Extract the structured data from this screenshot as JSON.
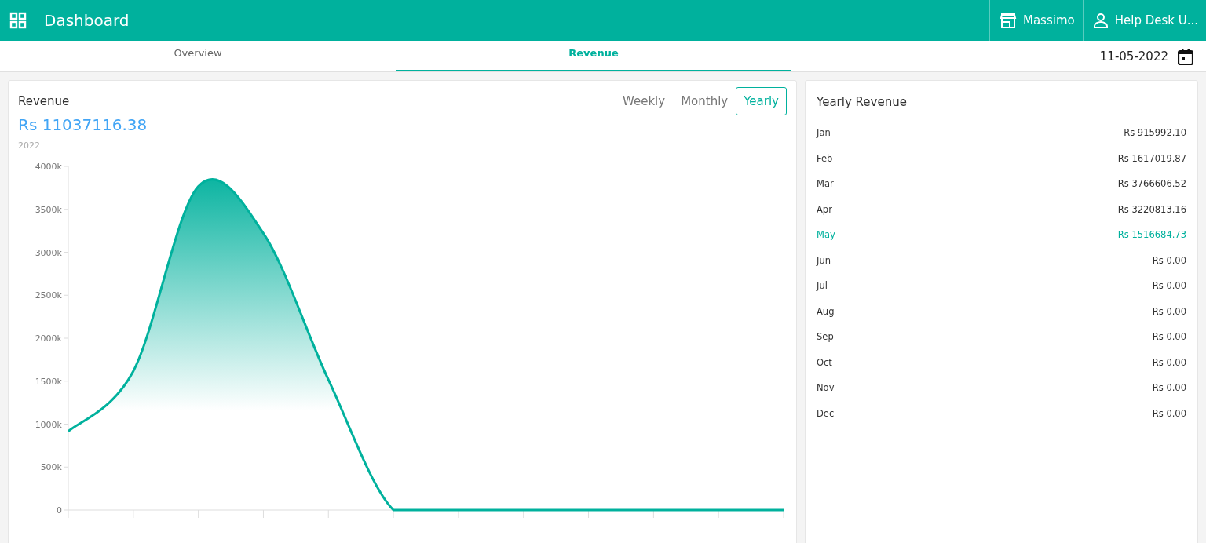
{
  "app_bar": {
    "title": "Dashboard",
    "store": "Massimo",
    "user": "Help Desk U..."
  },
  "tabs": [
    {
      "label": "Overview",
      "selected": false
    },
    {
      "label": "Revenue",
      "selected": true
    }
  ],
  "date": "11-05-2022",
  "revenue_card": {
    "title": "Revenue",
    "total": "Rs 11037116.38",
    "year": "2022",
    "periods": [
      {
        "label": "Weekly",
        "selected": false
      },
      {
        "label": "Monthly",
        "selected": false
      },
      {
        "label": "Yearly",
        "selected": true
      }
    ],
    "chart_data": {
      "type": "area",
      "ylim": [
        0,
        4000000
      ],
      "yticks": [
        {
          "value": 0,
          "label": "0"
        },
        {
          "value": 500000,
          "label": "500k"
        },
        {
          "value": 1000000,
          "label": "1000k"
        },
        {
          "value": 1500000,
          "label": "1500k"
        },
        {
          "value": 2000000,
          "label": "2000k"
        },
        {
          "value": 2500000,
          "label": "2500k"
        },
        {
          "value": 3000000,
          "label": "3000k"
        },
        {
          "value": 3500000,
          "label": "3500k"
        },
        {
          "value": 4000000,
          "label": "4000k"
        }
      ],
      "series": [
        {
          "color": "#00b19d",
          "values": [
            916000,
            1617000,
            3767000,
            3221000,
            1517000,
            0,
            0,
            0,
            0,
            0,
            0,
            0
          ]
        }
      ]
    }
  },
  "yearly_revenue": {
    "title": "Yearly Revenue",
    "rows": [
      {
        "month": "Jan",
        "amount": "Rs 915992.10",
        "selected": false
      },
      {
        "month": "Feb",
        "amount": "Rs 1617019.87",
        "selected": false
      },
      {
        "month": "Mar",
        "amount": "Rs 3766606.52",
        "selected": false
      },
      {
        "month": "Apr",
        "amount": "Rs 3220813.16",
        "selected": false
      },
      {
        "month": "May",
        "amount": "Rs 1516684.73",
        "selected": true
      },
      {
        "month": "Jun",
        "amount": "Rs 0.00",
        "selected": false
      },
      {
        "month": "Jul",
        "amount": "Rs 0.00",
        "selected": false
      },
      {
        "month": "Aug",
        "amount": "Rs 0.00",
        "selected": false
      },
      {
        "month": "Sep",
        "amount": "Rs 0.00",
        "selected": false
      },
      {
        "month": "Oct",
        "amount": "Rs 0.00",
        "selected": false
      },
      {
        "month": "Nov",
        "amount": "Rs 0.00",
        "selected": false
      },
      {
        "month": "Dec",
        "amount": "Rs 0.00",
        "selected": false
      }
    ]
  }
}
